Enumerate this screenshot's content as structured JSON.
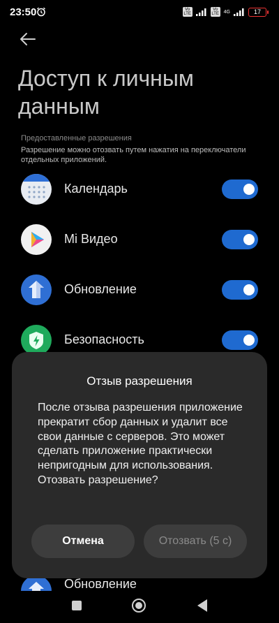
{
  "status_bar": {
    "time": "23:50",
    "volte_1": "Vo LTE",
    "volte_2": "Vo LTE",
    "lte_label": "4G",
    "battery": "17",
    "battery_color": "#e33333"
  },
  "header": {
    "title": "Доступ к личным данным"
  },
  "section": {
    "header": "Предоставленные разрешения",
    "description": "Разрешение можно отозвать путем нажатия на переключатели отдельных приложений."
  },
  "apps": [
    {
      "name": "Календарь",
      "icon": "calendar-icon",
      "enabled": true
    },
    {
      "name": "Mi Видео",
      "icon": "mi-video-icon",
      "enabled": true
    },
    {
      "name": "Обновление",
      "icon": "update-icon",
      "enabled": true
    },
    {
      "name": "Безопасность",
      "icon": "security-icon",
      "enabled": true
    }
  ],
  "bottom_app": {
    "name": "Обновление",
    "icon": "update-icon"
  },
  "dialog": {
    "title": "Отзыв разрешения",
    "message": "После отзыва разрешения приложение прекратит сбор данных и удалит все свои данные с серверов. Это может сделать приложение практически непригодным для использования. Отозвать разрешение?",
    "cancel_label": "Отмена",
    "confirm_label": "Отозвать (5 с)"
  },
  "colors": {
    "accent": "#1f6ad0",
    "dialog_bg": "#2a2a2a",
    "button_bg": "#3d3d3d"
  }
}
